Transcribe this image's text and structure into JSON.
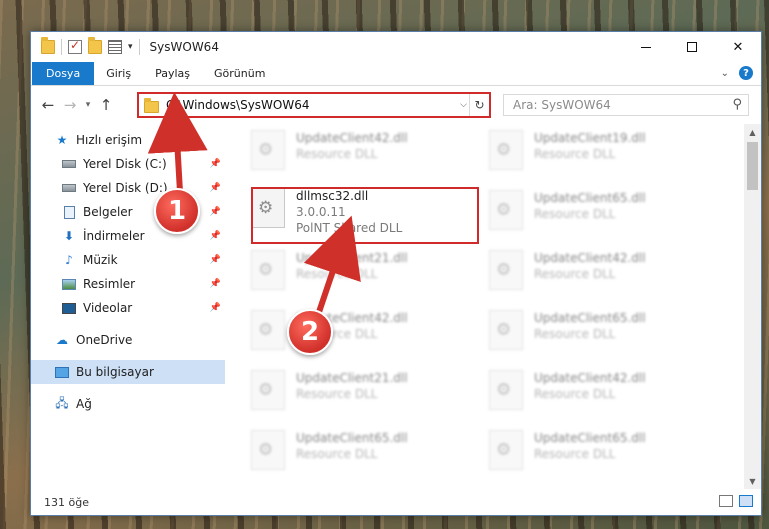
{
  "window": {
    "title": "SysWOW64"
  },
  "ribbon": {
    "tabs": [
      "Dosya",
      "Giriş",
      "Paylaş",
      "Görünüm"
    ]
  },
  "navbar": {
    "path": "C:\\Windows\\SysWOW64",
    "search_placeholder": "Ara: SysWOW64"
  },
  "sidebar": {
    "quick_access": "Hızlı erişim",
    "items": [
      {
        "label": "Yerel Disk (C:)",
        "icon": "disk-icon"
      },
      {
        "label": "Yerel Disk (D:)",
        "icon": "disk-icon"
      },
      {
        "label": "Belgeler",
        "icon": "documents-icon"
      },
      {
        "label": "İndirmeler",
        "icon": "downloads-icon"
      },
      {
        "label": "Müzik",
        "icon": "music-icon"
      },
      {
        "label": "Resimler",
        "icon": "pictures-icon"
      },
      {
        "label": "Videolar",
        "icon": "videos-icon"
      }
    ],
    "onedrive": "OneDrive",
    "this_pc": "Bu bilgisayar",
    "network": "Ağ"
  },
  "files": {
    "highlighted": {
      "name": "dllmsc32.dll",
      "version": "3.0.0.11",
      "description": "PolNT Shared DLL"
    },
    "left_column": [
      {
        "name": "UpdateClient42.dll",
        "type": "Resource DLL"
      },
      {
        "name": "UpdateClient21.dll",
        "type": "Resource DLL"
      },
      {
        "name": "UpdateClient42.dll",
        "type": "Resource DLL"
      },
      {
        "name": "UpdateClient21.dll",
        "type": "Resource DLL"
      },
      {
        "name": "UpdateClient65.dll",
        "type": "Resource DLL"
      }
    ],
    "right_column": [
      {
        "name": "UpdateClient19.dll",
        "type": "Resource DLL"
      },
      {
        "name": "UpdateClient65.dll",
        "type": "Resource DLL"
      },
      {
        "name": "UpdateClient42.dll",
        "type": "Resource DLL"
      },
      {
        "name": "UpdateClient65.dll",
        "type": "Resource DLL"
      },
      {
        "name": "UpdateClient42.dll",
        "type": "Resource DLL"
      },
      {
        "name": "UpdateClient65.dll",
        "type": "Resource DLL"
      }
    ]
  },
  "status": {
    "count": "131 öğe"
  },
  "annotations": {
    "step1": "1",
    "step2": "2",
    "color": "#d0302a"
  },
  "colors": {
    "accent": "#1979ca",
    "highlight": "#d02a2a",
    "selected": "#cde0f5"
  }
}
